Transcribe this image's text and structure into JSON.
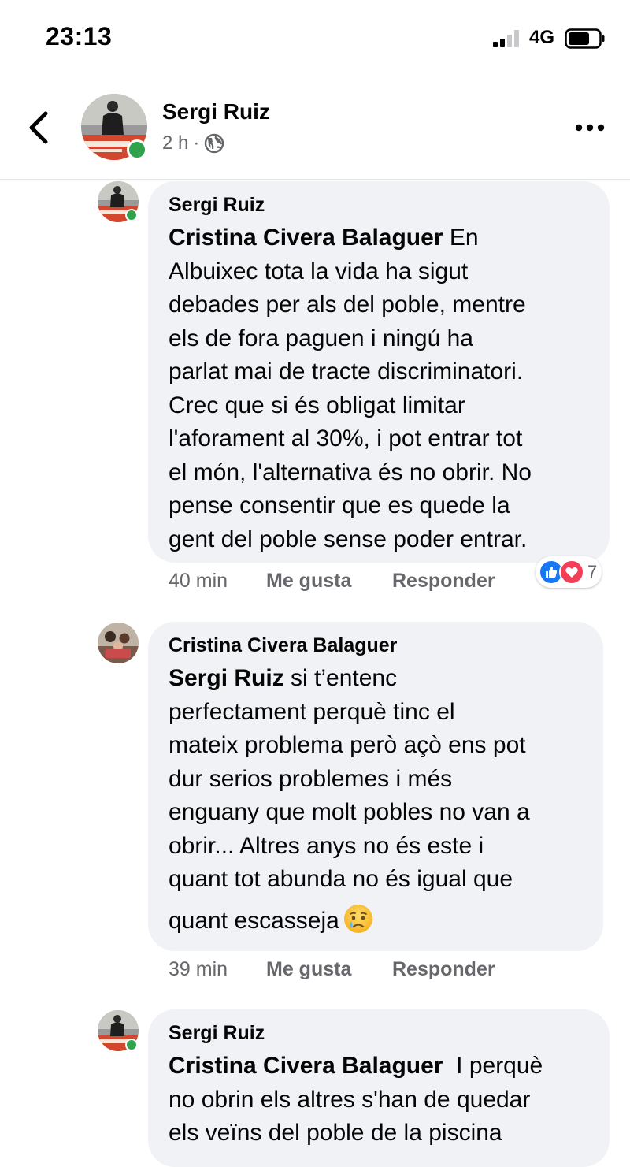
{
  "status_bar": {
    "time": "23:13",
    "network": "4G",
    "signal_icon": "cell-signal-icon",
    "battery_icon": "battery-icon"
  },
  "header": {
    "author_name": "Sergi Ruiz",
    "time_ago": "2 h",
    "separator": "·",
    "privacy_icon": "globe-icon",
    "back_icon": "chevron-left-icon",
    "more_icon": "more-horizontal-icon",
    "online": true
  },
  "comments": [
    {
      "author": "Sergi Ruiz",
      "mention": "Cristina Civera Balaguer",
      "lines": [
        " En",
        "Albuixec tota la vida ha sigut",
        "debades per als del poble, mentre",
        "els de fora paguen i ningú ha",
        "parlat mai de tracte discriminatori.",
        "Crec que si és obligat limitar",
        "l'aforament al 30%, i pot entrar tot",
        "el món, l'alternativa és no obrir. No",
        "pense consentir que es quede la",
        "gent del poble sense poder entrar."
      ],
      "time": "40 min",
      "like_label": "Me gusta",
      "reply_label": "Responder",
      "reactions": [
        "like-icon",
        "love-icon"
      ],
      "reaction_count": "7",
      "online": true
    },
    {
      "author": "Cristina Civera Balaguer",
      "mention": "Sergi Ruiz",
      "lines": [
        " si t’entenc",
        "perfectament perquè tinc el",
        "mateix problema però açò ens pot",
        "dur serios problemes i més",
        "enguany que molt pobles no van a",
        "obrir...  Altres anys no és este i",
        "quant tot abunda no és igual que",
        "quant escasseja"
      ],
      "emoji": "crying-face-icon",
      "time": "39 min",
      "like_label": "Me gusta",
      "reply_label": "Responder",
      "online": false
    },
    {
      "author": "Sergi Ruiz",
      "mention": "Cristina Civera Balaguer",
      "lines": [
        "  I perquè",
        "no obrin els altres s'han de quedar",
        "els veïns del poble de la piscina"
      ],
      "online": true
    }
  ],
  "colors": {
    "bubble_bg": "#f0f2f5",
    "secondary_text": "#65676b",
    "online_green": "#31a24c",
    "like_blue": "#1877f2",
    "love_red": "#f33e58"
  }
}
